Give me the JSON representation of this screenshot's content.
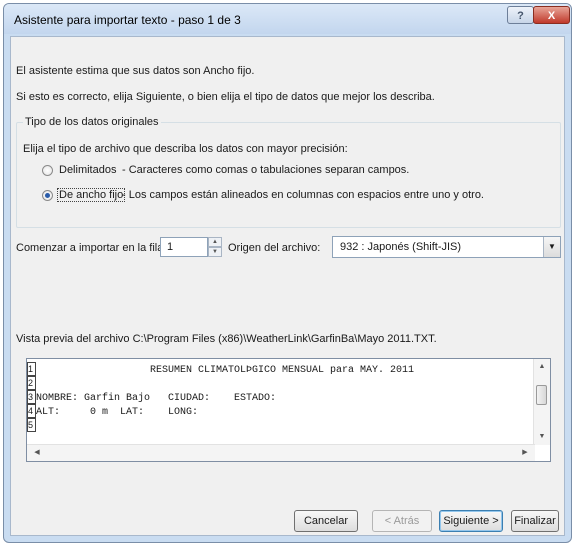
{
  "window": {
    "title": "Asistente para importar texto - paso 1 de 3",
    "help_label": "?",
    "close_label": "X"
  },
  "intro": {
    "line1": "El asistente estima que sus datos son Ancho fijo.",
    "line2": "Si esto es correcto, elija Siguiente, o bien elija el tipo de datos que mejor los describa."
  },
  "original_type": {
    "group_label": "Tipo de los datos originales",
    "prompt": "Elija el tipo de archivo que describa los datos con mayor precisión:",
    "options": [
      {
        "label": "Delimitados",
        "description": "- Caracteres como comas o tabulaciones separan campos.",
        "selected": false
      },
      {
        "label": "De ancho fijo",
        "description": "- Los campos están alineados en columnas con espacios entre uno y otro.",
        "selected": true
      }
    ]
  },
  "import_row": {
    "label": "Comenzar a importar en la fila:",
    "value": "1"
  },
  "origin": {
    "label": "Origen del archivo:",
    "value": "932 : Japonés (Shift-JIS)"
  },
  "preview": {
    "label": "Vista previa del archivo C:\\Program Files (x86)\\WeatherLink\\GarfinBa\\Mayo 2011.TXT.",
    "lines": [
      {
        "num": "1",
        "text": "                   RESUMEN CLIMATOLÞGICO MENSUAL para MAY. 2011"
      },
      {
        "num": "2",
        "text": ""
      },
      {
        "num": "3",
        "text": "NOMBRE: Garfin Bajo   CIUDAD:    ESTADO:"
      },
      {
        "num": "4",
        "text": "ALT:     0 m  LAT:    LONG:"
      },
      {
        "num": "5",
        "text": ""
      }
    ]
  },
  "buttons": {
    "cancel": "Cancelar",
    "back": "< Atrás",
    "next": "Siguiente >",
    "finish": "Finalizar"
  }
}
